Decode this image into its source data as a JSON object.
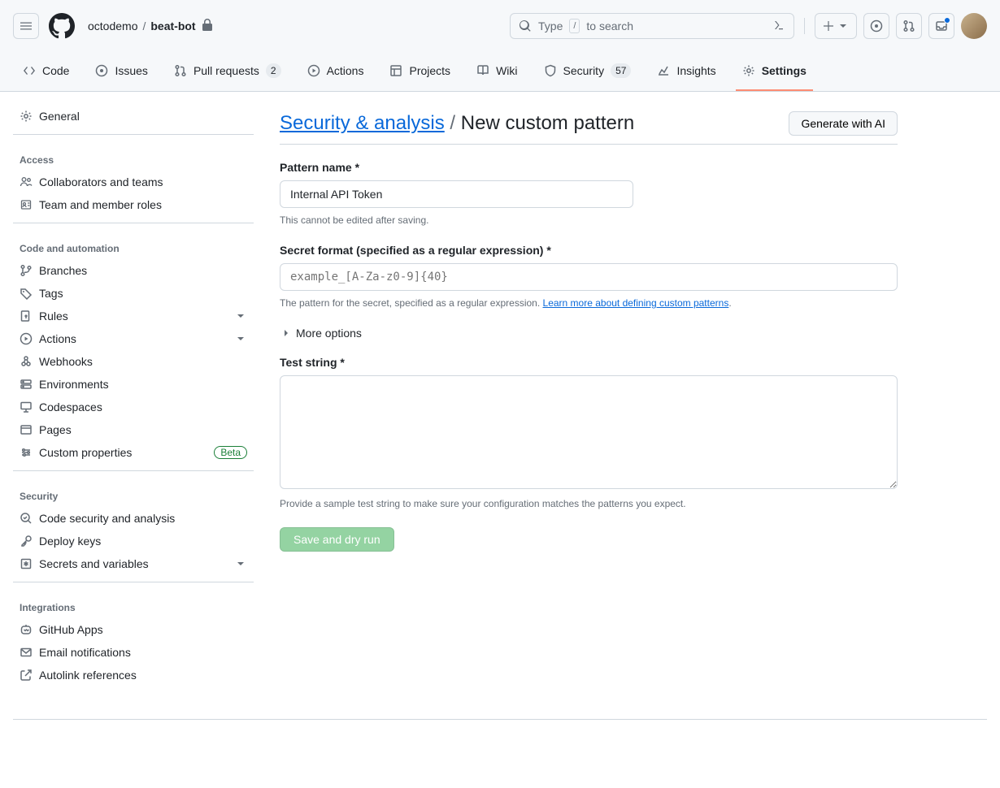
{
  "header": {
    "owner": "octodemo",
    "repo": "beat-bot",
    "search_prefix": "Type",
    "search_key": "/",
    "search_suffix": "to search"
  },
  "tabs": {
    "code": "Code",
    "issues": "Issues",
    "pulls": "Pull requests",
    "pulls_count": "2",
    "actions": "Actions",
    "projects": "Projects",
    "wiki": "Wiki",
    "security": "Security",
    "security_count": "57",
    "insights": "Insights",
    "settings": "Settings"
  },
  "sidebar": {
    "general": "General",
    "access_heading": "Access",
    "collab": "Collaborators and teams",
    "team_roles": "Team and member roles",
    "code_auto_heading": "Code and automation",
    "branches": "Branches",
    "tags": "Tags",
    "rules": "Rules",
    "actions": "Actions",
    "webhooks": "Webhooks",
    "environments": "Environments",
    "codespaces": "Codespaces",
    "pages": "Pages",
    "custom_props": "Custom properties",
    "beta": "Beta",
    "security_heading": "Security",
    "code_security": "Code security and analysis",
    "deploy_keys": "Deploy keys",
    "secrets_vars": "Secrets and variables",
    "integrations_heading": "Integrations",
    "github_apps": "GitHub Apps",
    "email_notif": "Email notifications",
    "autolink": "Autolink references"
  },
  "page": {
    "breadcrumb_link": "Security & analysis",
    "breadcrumb_sep": "/",
    "title": "New custom pattern",
    "generate_btn": "Generate with AI",
    "pattern_name_label": "Pattern name *",
    "pattern_name_value": "Internal API Token",
    "pattern_name_help": "This cannot be edited after saving.",
    "secret_format_label": "Secret format (specified as a regular expression) *",
    "secret_format_placeholder": "example_[A-Za-z0-9]{40}",
    "secret_format_help_pre": "The pattern for the secret, specified as a regular expression. ",
    "secret_format_help_link": "Learn more about defining custom patterns",
    "more_options": "More options",
    "test_string_label": "Test string *",
    "test_string_help": "Provide a sample test string to make sure your configuration matches the patterns you expect.",
    "save_btn": "Save and dry run"
  }
}
